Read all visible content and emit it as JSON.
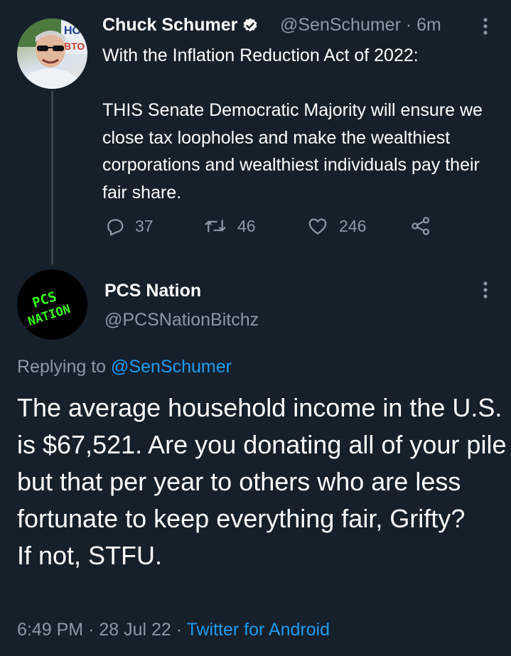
{
  "tweet": {
    "author_name": "Chuck Schumer",
    "handle": "@SenSchumer",
    "separator": "·",
    "time": "6m",
    "text": "With the Inflation Reduction Act of 2022:\n\nTHIS Senate Democratic Majority will ensure we close tax loopholes and make the wealthiest corporations and wealthiest individuals pay their fair share.",
    "avatar_text": "HO BTO",
    "replies_count": "37",
    "retweets_count": "46",
    "likes_count": "246"
  },
  "reply": {
    "author_name": "PCS Nation",
    "handle": "@PCSNationBitchz",
    "avatar_text_line1": "PCS",
    "avatar_text_line2": "NATION",
    "replying_label": "Replying to",
    "replying_to": "@SenSchumer",
    "text": "The average household income in the U.S. is $67,521. Are you donating all of your pile but that per year to others who are less fortunate to keep everything fair, Grifty?\nIf not, STFU.",
    "time": "6:49 PM",
    "separator": "·",
    "date": "28 Jul 22",
    "separator2": "·",
    "source": "Twitter for Android"
  },
  "icons": [
    "verified-badge-icon",
    "more-options-icon",
    "reply-icon",
    "retweet-icon",
    "like-icon",
    "share-icon"
  ],
  "colors": {
    "background": "#15202b",
    "text": "#ffffff",
    "secondary": "#8b98a5",
    "link": "#1d9bf0",
    "avatar_lettering": "#39ff14"
  }
}
